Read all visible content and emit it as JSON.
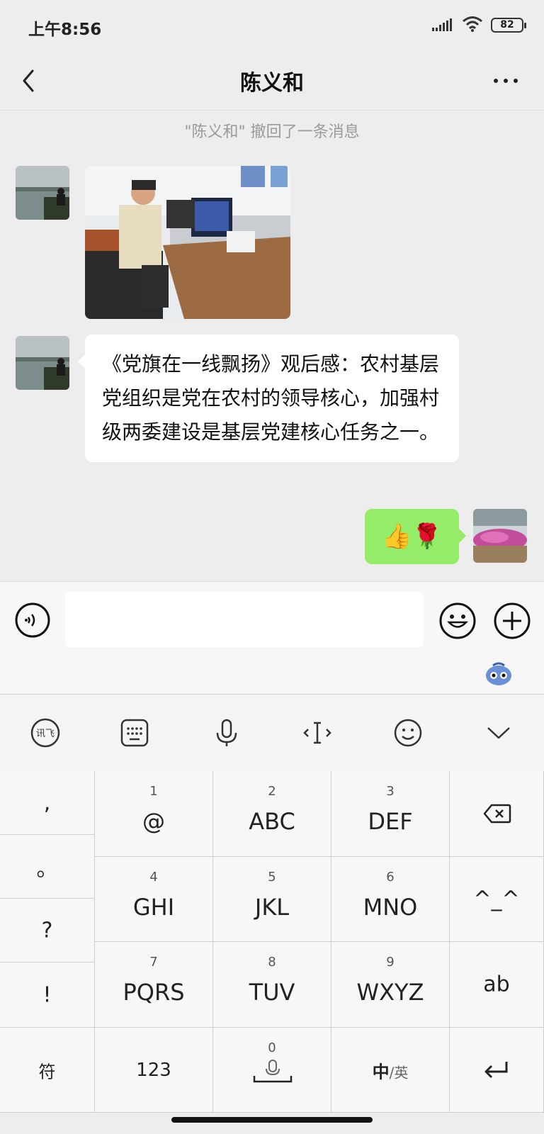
{
  "status_bar": {
    "time": "上午8:56",
    "battery": "82"
  },
  "header": {
    "title": "陈义和"
  },
  "chat": {
    "recall_notice": "\"陈义和\" 撤回了一条消息",
    "text_message": "《党旗在一线飘扬》观后感：农村基层党组织是党在农村的领导核心，加强村级两委建设是基层党建核心任务之一。",
    "sent_emoji": "👍🌹"
  },
  "input": {
    "value": "",
    "placeholder": ""
  },
  "keyboard": {
    "punctuation": [
      ",",
      "。",
      "?",
      "!"
    ],
    "rows": [
      [
        {
          "num": "1",
          "label": "@"
        },
        {
          "num": "2",
          "label": "ABC"
        },
        {
          "num": "3",
          "label": "DEF"
        }
      ],
      [
        {
          "num": "4",
          "label": "GHI"
        },
        {
          "num": "5",
          "label": "JKL"
        },
        {
          "num": "6",
          "label": "MNO"
        }
      ],
      [
        {
          "num": "7",
          "label": "PQRS"
        },
        {
          "num": "8",
          "label": "TUV"
        },
        {
          "num": "9",
          "label": "WXYZ"
        }
      ]
    ],
    "emoticon_key": "^_^",
    "ab_key": "ab",
    "symbol_key": "符",
    "number_key": "123",
    "space_num": "0",
    "lang_key_main": "中",
    "lang_key_sub": "/英"
  },
  "colors": {
    "background": "#ededed",
    "sent_bubble": "#95ec69",
    "received_bubble": "#ffffff"
  }
}
